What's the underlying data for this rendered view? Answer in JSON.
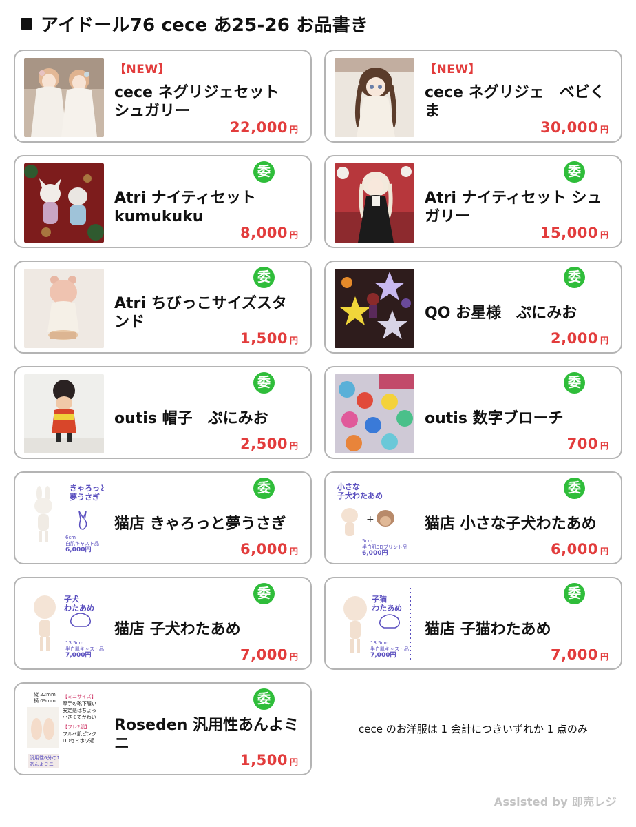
{
  "header": {
    "title": "アイドール76 cece あ25-26 お品書き"
  },
  "currency_unit": "円",
  "badges": {
    "new": "【NEW】",
    "consignment": "委"
  },
  "colors": {
    "price": "#e23c3c",
    "badge_consignment": "#2fbd3a",
    "card_border": "#b4b4b4"
  },
  "items": [
    {
      "name": "cece ネグリジェセット シュガリー",
      "price": "22,000",
      "badge": "new",
      "image": "two-dolls-white-nightgowns"
    },
    {
      "name": "cece ネグリジェ　ベビくま",
      "price": "30,000",
      "badge": "new",
      "image": "doll-braids-bear-hat"
    },
    {
      "name": "Atri ナイティセット kumukuku",
      "price": "8,000",
      "badge": "consignment",
      "image": "plush-animal-dolls-red"
    },
    {
      "name": "Atri ナイティセット シュガリー",
      "price": "15,000",
      "badge": "consignment",
      "image": "doll-black-dress-red-bg"
    },
    {
      "name": "Atri ちびっこサイズスタンド",
      "price": "1,500",
      "badge": "consignment",
      "image": "bear-figure-stand"
    },
    {
      "name": "QO お星様　ぷにみお",
      "price": "2,000",
      "badge": "consignment",
      "image": "star-plush-doll"
    },
    {
      "name": "outis 帽子　ぷにみお",
      "price": "2,500",
      "badge": "consignment",
      "image": "doll-fur-hat"
    },
    {
      "name": "outis 数字ブローチ",
      "price": "700",
      "badge": "consignment",
      "image": "number-brooches"
    },
    {
      "name": "猫店 きゃろっと夢うさぎ",
      "price": "6,000",
      "badge": "consignment",
      "image": "white-rabbit-doll",
      "thumb_text": {
        "title1": "きゃろっと",
        "title2": "夢うさぎ",
        "size": "6cm",
        "spec": "白肌キャスト品",
        "price": "6,000円"
      }
    },
    {
      "name": "猫店 小さな子犬わたあめ",
      "price": "6,000",
      "badge": "consignment",
      "image": "puppy-doll-head",
      "thumb_text": {
        "title1": "小さな",
        "title2": "子犬わたあめ",
        "size": "5cm",
        "spec": "半白肌3Dプリント品",
        "price": "6,000円"
      }
    },
    {
      "name": "猫店 子犬わたあめ",
      "price": "7,000",
      "badge": "consignment",
      "image": "puppy-doll-body",
      "thumb_text": {
        "title1": "子犬",
        "title2": "わたあめ",
        "size": "13.5cm",
        "spec": "半白肌キャスト品",
        "price": "7,000円"
      }
    },
    {
      "name": "猫店 子猫わたあめ",
      "price": "7,000",
      "badge": "consignment",
      "image": "kitten-doll-body",
      "thumb_text": {
        "title1": "子猫",
        "title2": "わたあめ",
        "size": "13.5cm",
        "spec": "半白肌キャスト品",
        "price": "7,000円"
      }
    },
    {
      "name": "Roseden 汎用性あんよミニ",
      "price": "1,500",
      "badge": "consignment",
      "image": "doll-feet-parts",
      "thumb_text": {
        "dim1": "縦 22mm",
        "dim2": "横 09mm",
        "tag1": "【ミニサイズ】",
        "line1": "厚手の靴下履い",
        "line2": "安定感はちょっ",
        "line3": "小さくてかわい",
        "tag2": "【フレ2肌】",
        "line4": "フルベ肌ピンク",
        "line5": "DDセミホワ近",
        "caption1": "汎用性6分の1",
        "caption2": "あんよミニ"
      }
    }
  ],
  "note": "cece のお洋服は 1 会計につきいずれか 1 点のみ",
  "footer": "Assisted by 即売レジ"
}
